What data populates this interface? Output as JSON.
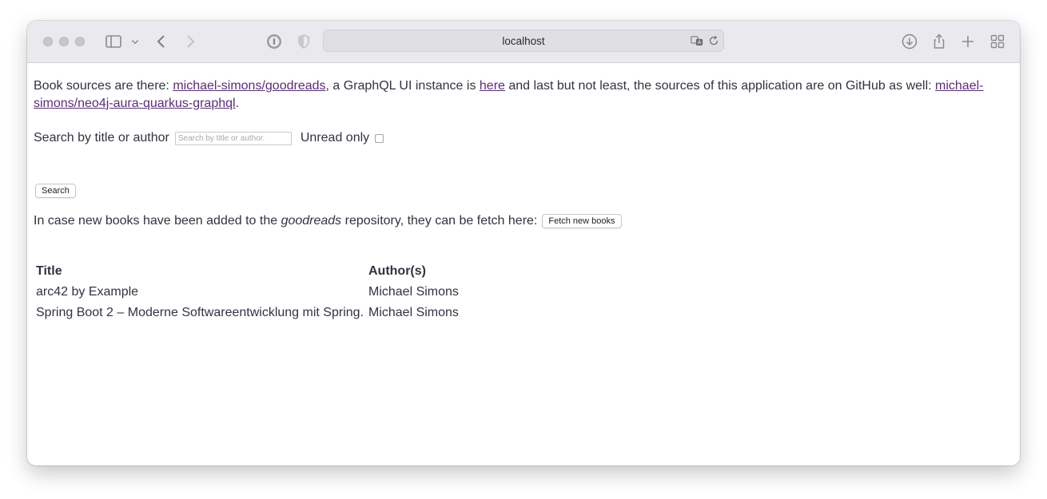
{
  "browser": {
    "url": "localhost"
  },
  "intro": {
    "text_1": "Book sources are there: ",
    "link_1": "michael-simons/goodreads",
    "text_2": ", a GraphQL UI instance is ",
    "link_2": "here",
    "text_3": " and last but not least, the sources of this application are on GitHub as well: ",
    "link_3": "michael-simons/neo4j-aura-quarkus-graphql",
    "text_4": "."
  },
  "search": {
    "label": "Search by title or author",
    "placeholder": "Search by title or author.",
    "value": "",
    "unread_label": "Unread only",
    "unread_checked": false,
    "button_label": "Search"
  },
  "fetch": {
    "text_1": "In case new books have been added to the ",
    "emphasis": "goodreads",
    "text_2": " repository, they can be fetch here:",
    "button_label": "Fetch new books"
  },
  "table": {
    "headers": [
      "Title",
      "Author(s)"
    ],
    "rows": [
      [
        "arc42 by Example",
        "Michael Simons"
      ],
      [
        "Spring Boot 2 – Moderne Softwareentwicklung mit Spring.",
        "Michael Simons"
      ]
    ]
  },
  "theme": {
    "link_color": "#5a2d7a",
    "text_color": "#2f3440",
    "toolbar_bg": "#e9e9ee"
  }
}
